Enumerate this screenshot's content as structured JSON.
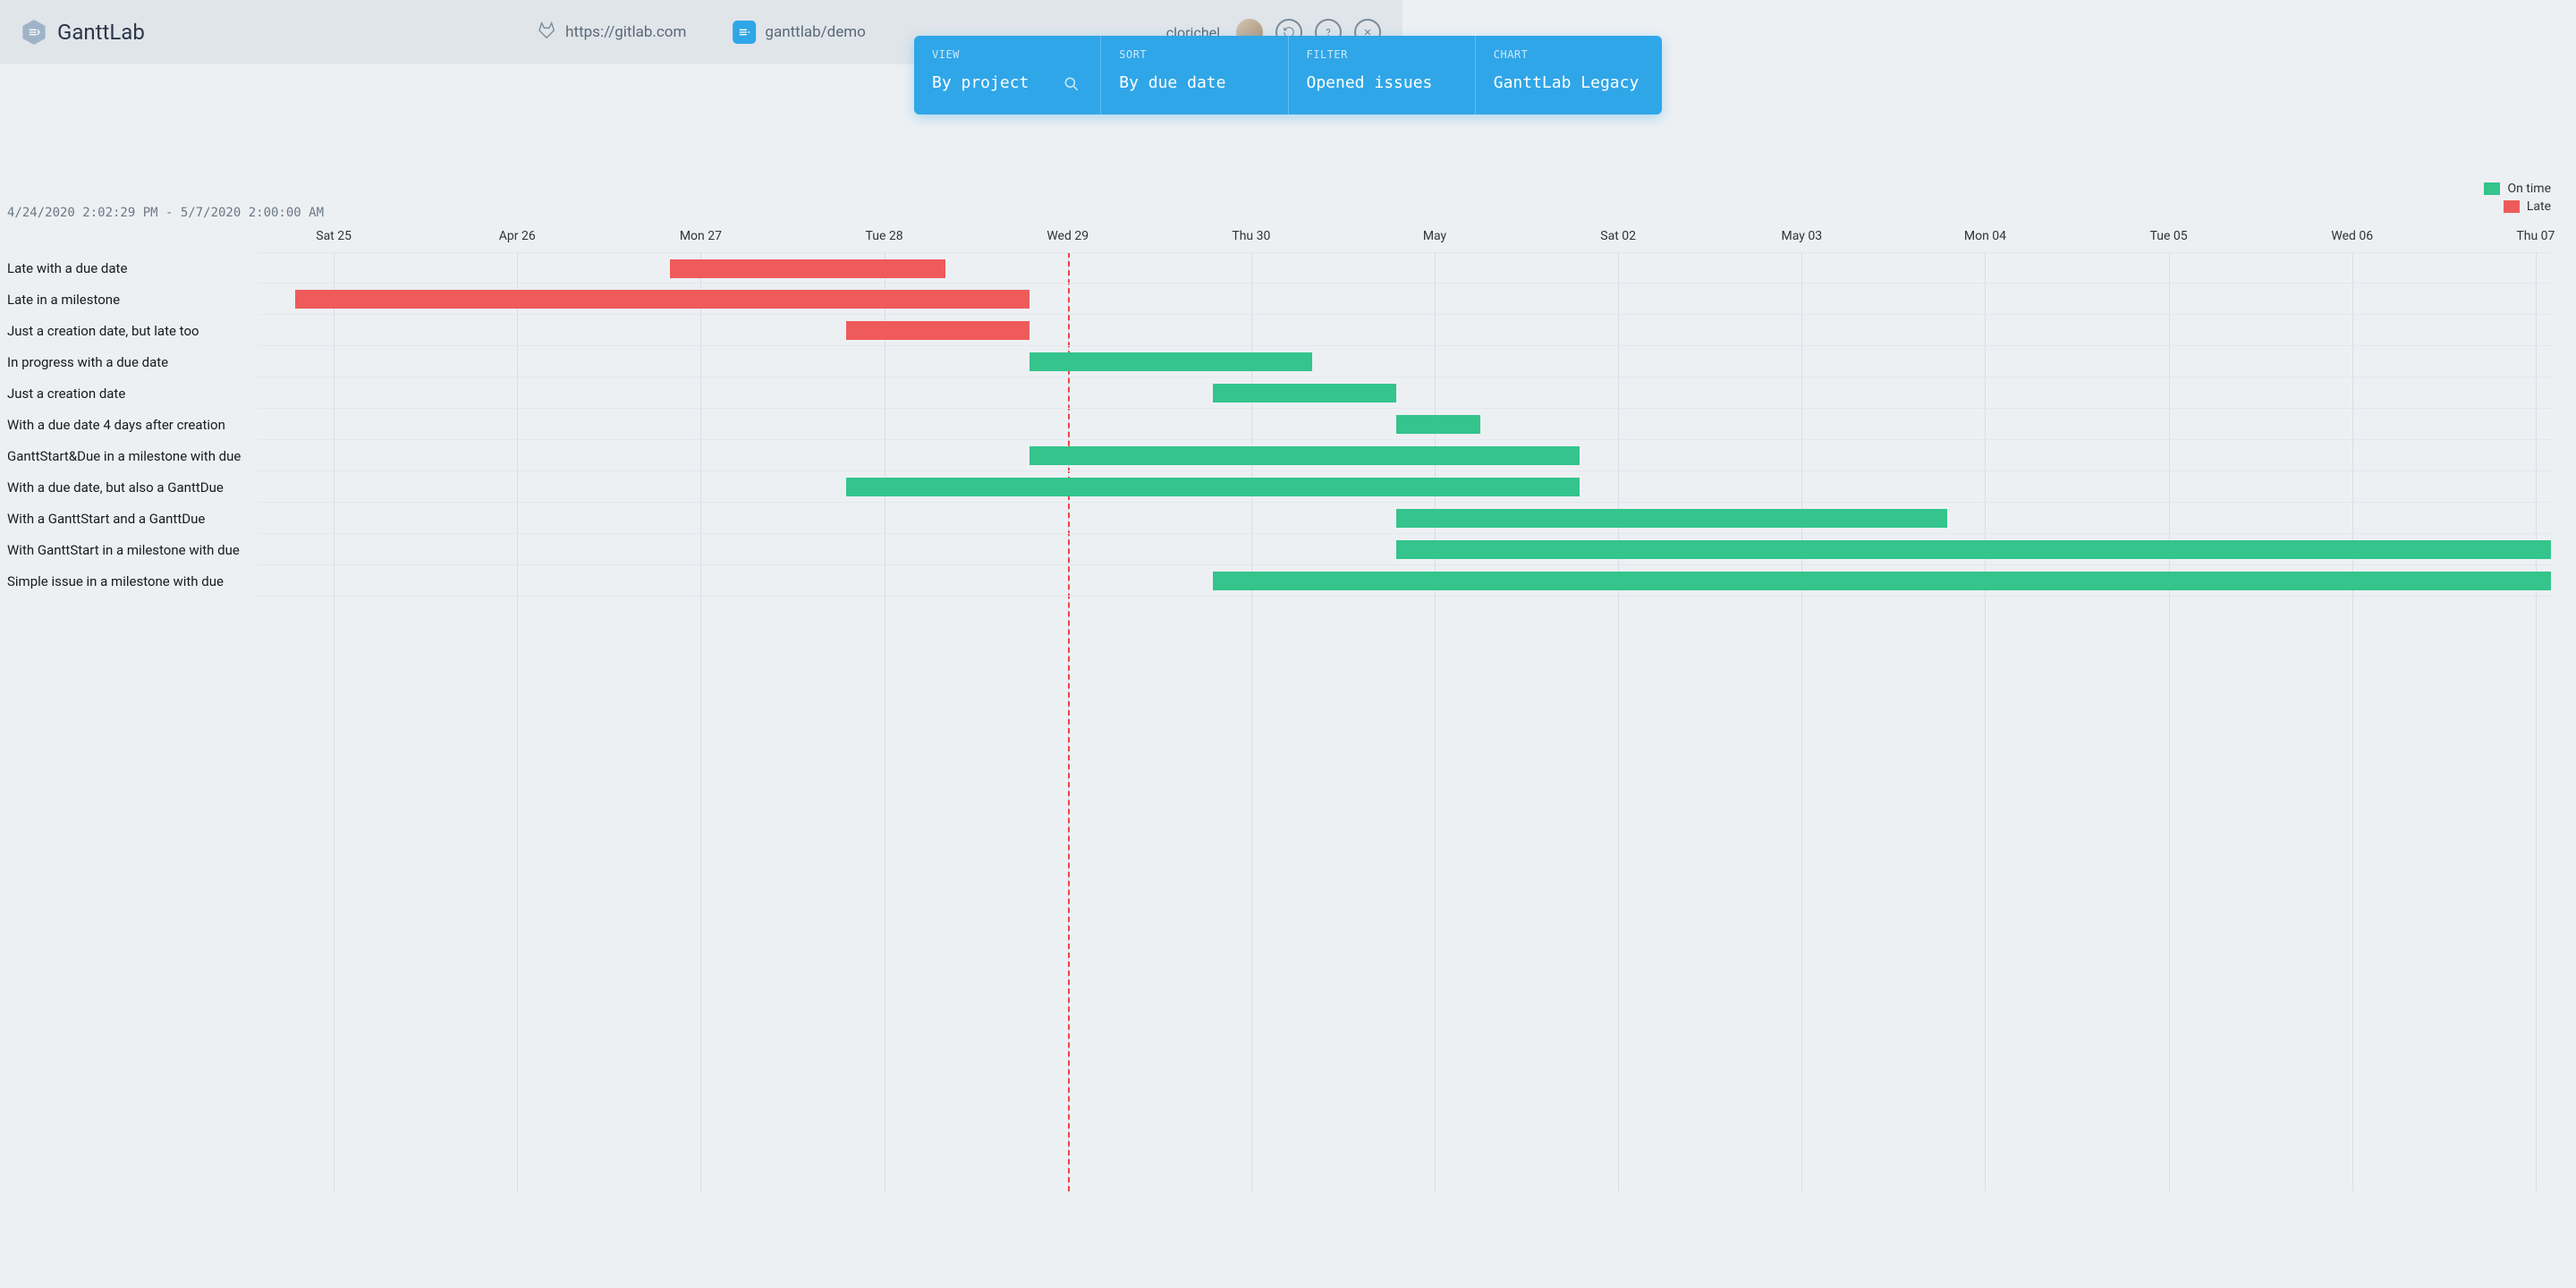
{
  "header": {
    "app_name": "GanttLab",
    "source_url": "https://gitlab.com",
    "project_path": "ganttlab/demo",
    "username": "clorichel"
  },
  "controls": {
    "view": {
      "label": "VIEW",
      "value": "By project"
    },
    "sort": {
      "label": "SORT",
      "value": "By due date"
    },
    "filter": {
      "label": "FILTER",
      "value": "Opened issues"
    },
    "chart": {
      "label": "CHART",
      "value": "GanttLab Legacy"
    }
  },
  "legend": {
    "on_time": "On time",
    "late": "Late",
    "colors": {
      "on_time": "#34c48c",
      "late": "#ef5b5b"
    }
  },
  "date_range": "4/24/2020 2:02:29 PM - 5/7/2020 2:00:00 AM",
  "chart_data": {
    "type": "bar",
    "x_domain": {
      "start": "2020-04-24T14:02:29",
      "end": "2020-05-07T02:00:00"
    },
    "today_marker": "2020-04-29",
    "columns": [
      {
        "label": "Sat 25",
        "date": "2020-04-25"
      },
      {
        "label": "Apr 26",
        "date": "2020-04-26"
      },
      {
        "label": "Mon 27",
        "date": "2020-04-27"
      },
      {
        "label": "Tue 28",
        "date": "2020-04-28"
      },
      {
        "label": "Wed 29",
        "date": "2020-04-29"
      },
      {
        "label": "Thu 30",
        "date": "2020-04-30"
      },
      {
        "label": "May",
        "date": "2020-05-01"
      },
      {
        "label": "Sat 02",
        "date": "2020-05-02"
      },
      {
        "label": "May 03",
        "date": "2020-05-03"
      },
      {
        "label": "Mon 04",
        "date": "2020-05-04"
      },
      {
        "label": "Tue 05",
        "date": "2020-05-05"
      },
      {
        "label": "Wed 06",
        "date": "2020-05-06"
      },
      {
        "label": "Thu 07",
        "date": "2020-05-07"
      }
    ],
    "tasks": [
      {
        "label": "Late with a due date",
        "start": "2020-04-26T20:00",
        "end": "2020-04-28T08:00",
        "status": "late"
      },
      {
        "label": "Late in a milestone",
        "start": "2020-04-24T19:00",
        "end": "2020-04-28T19:00",
        "status": "late"
      },
      {
        "label": "Just a creation date, but late too",
        "start": "2020-04-27T19:00",
        "end": "2020-04-28T19:00",
        "status": "late"
      },
      {
        "label": "In progress with a due date",
        "start": "2020-04-28T19:00",
        "end": "2020-04-30T08:00",
        "status": "ontime"
      },
      {
        "label": "Just a creation date",
        "start": "2020-04-29T19:00",
        "end": "2020-04-30T19:00",
        "status": "ontime"
      },
      {
        "label": "With a due date 4 days after creation",
        "start": "2020-04-30T19:00",
        "end": "2020-05-01T06:00",
        "status": "ontime"
      },
      {
        "label": "GanttStart&Due in a milestone with due",
        "start": "2020-04-28T19:00",
        "end": "2020-05-01T19:00",
        "status": "ontime"
      },
      {
        "label": "With a due date, but also a GanttDue",
        "start": "2020-04-27T19:00",
        "end": "2020-05-01T19:00",
        "status": "ontime"
      },
      {
        "label": "With a GanttStart and a GanttDue",
        "start": "2020-04-30T19:00",
        "end": "2020-05-03T19:00",
        "status": "ontime"
      },
      {
        "label": "With GanttStart in a milestone with due",
        "start": "2020-04-30T19:00",
        "end": "2020-05-07T02:00",
        "status": "ontime"
      },
      {
        "label": "Simple issue in a milestone with due",
        "start": "2020-04-29T19:00",
        "end": "2020-05-07T02:00",
        "status": "ontime"
      }
    ]
  }
}
